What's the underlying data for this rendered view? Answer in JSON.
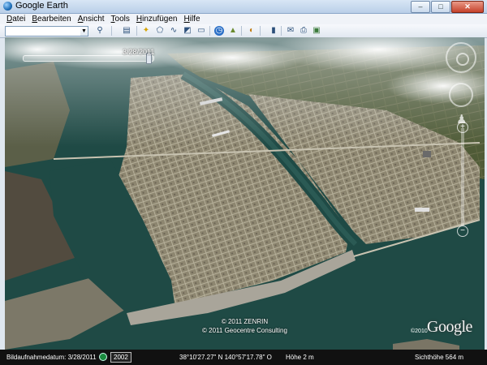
{
  "window": {
    "title": "Google Earth",
    "buttons": [
      "–",
      "□",
      "✕"
    ]
  },
  "menu": [
    {
      "label": "Datei",
      "u": "D",
      "rest": "atei"
    },
    {
      "label": "Bearbeiten",
      "u": "B",
      "rest": "earbeiten"
    },
    {
      "label": "Ansicht",
      "u": "A",
      "rest": "nsicht"
    },
    {
      "label": "Tools",
      "u": "T",
      "rest": "ools"
    },
    {
      "label": "Hinzufügen",
      "u": "H",
      "rest": "inzufügen"
    },
    {
      "label": "Hilfe",
      "u": "H",
      "rest": "ilfe"
    }
  ],
  "toolbar": {
    "search_value": "",
    "icons": [
      "search-icon",
      "sidebar-toggle-icon",
      "placemark-icon",
      "polygon-icon",
      "path-icon",
      "image-overlay-icon",
      "record-tour-icon",
      "historical-imagery-icon",
      "sunlight-icon",
      "planets-icon",
      "ruler-icon",
      "email-icon",
      "print-icon",
      "view-in-maps-icon"
    ]
  },
  "map": {
    "time_slider_date": "3/28/2011",
    "copyright_line1": "© 2011 ZENRIN",
    "copyright_line2": "© 2011 Geocentre Consulting",
    "year_mark": "©2010",
    "logo": "Google",
    "colors": {
      "water": "#1f4a45",
      "land": "#8f8a74",
      "fields": "#4d5a34"
    }
  },
  "status": {
    "imagery_date": "Bildaufnahmedatum: 3/28/2011",
    "year_badge": "2002",
    "coords": "38°10'27.27\" N 140°57'17.78\" O",
    "height": "Höhe    2 m",
    "eye_alt": "Sichthöhe    564 m"
  }
}
